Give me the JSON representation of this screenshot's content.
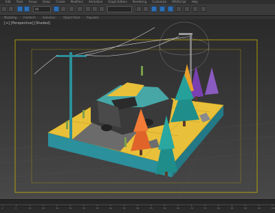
{
  "menu": {
    "items": [
      "Edit",
      "Tools",
      "Group",
      "Views",
      "Create",
      "Modifiers",
      "Animation",
      "Graph Editors",
      "Rendering",
      "Customize",
      "MAXScript",
      "Help"
    ]
  },
  "toolbar": {
    "selection_filter": "All"
  },
  "ribbon": {
    "tabs": [
      "Modeling",
      "Freeform",
      "Selection",
      "Object Paint",
      "Populate"
    ]
  },
  "viewport": {
    "label": "[+] [Perspective] [Shaded]"
  },
  "timeline": {
    "ticks": [
      "0",
      "5",
      "10",
      "15",
      "20",
      "25",
      "30",
      "35",
      "40",
      "45",
      "50",
      "55",
      "60",
      "65",
      "70",
      "75",
      "80",
      "85",
      "90",
      "95",
      "100"
    ]
  },
  "colors": {
    "ground_yellow": "#e9c03a",
    "ground_side": "#2b8f9c",
    "truck_teal": "#46a7a6",
    "tree_teal": "#1f8e8a",
    "tree_orange": "#e0642a",
    "tree_purple": "#7a3fb0",
    "safe_frame": "#c8b400"
  }
}
